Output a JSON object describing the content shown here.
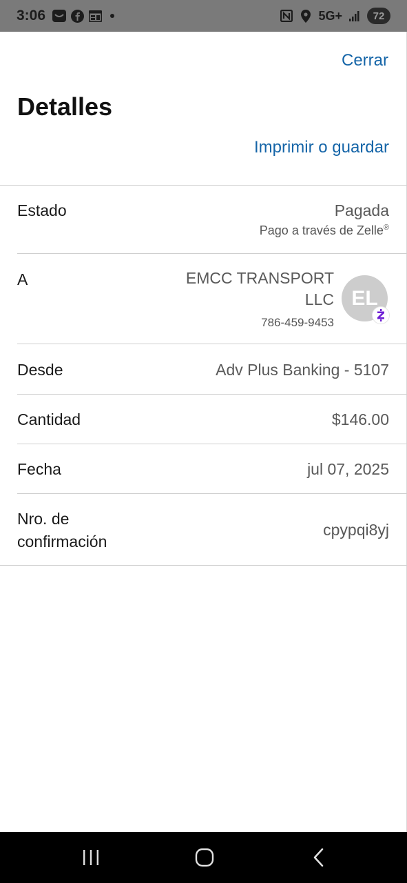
{
  "status_bar": {
    "time": "3:06",
    "network": "5G+",
    "battery": "72",
    "icons": [
      "mail-icon",
      "facebook-icon",
      "calendar-icon",
      "nfc-icon",
      "location-icon",
      "signal-icon"
    ]
  },
  "header": {
    "close_label": "Cerrar",
    "title": "Detalles",
    "print_label": "Imprimir o guardar"
  },
  "details": {
    "status": {
      "label": "Estado",
      "value": "Pagada",
      "sub": "Pago a través de Zelle",
      "sub_mark": "®"
    },
    "recipient": {
      "label": "A",
      "name": "EMCC TRANSPORT LLC",
      "phone": "786-459-9453",
      "initials": "EL"
    },
    "from": {
      "label": "Desde",
      "value": "Adv Plus Banking - 5107"
    },
    "amount": {
      "label": "Cantidad",
      "value": "$146.00"
    },
    "date": {
      "label": "Fecha",
      "value": "jul 07, 2025"
    },
    "confirmation": {
      "label_line1": "Nro. de",
      "label_line2": "confirmación",
      "value": "cpypqi8yj"
    }
  },
  "colors": {
    "link": "#1565a8",
    "zelle_purple": "#6d1ed4",
    "status_bar_bg": "#7a7a7a",
    "nav_bg": "#000000"
  }
}
